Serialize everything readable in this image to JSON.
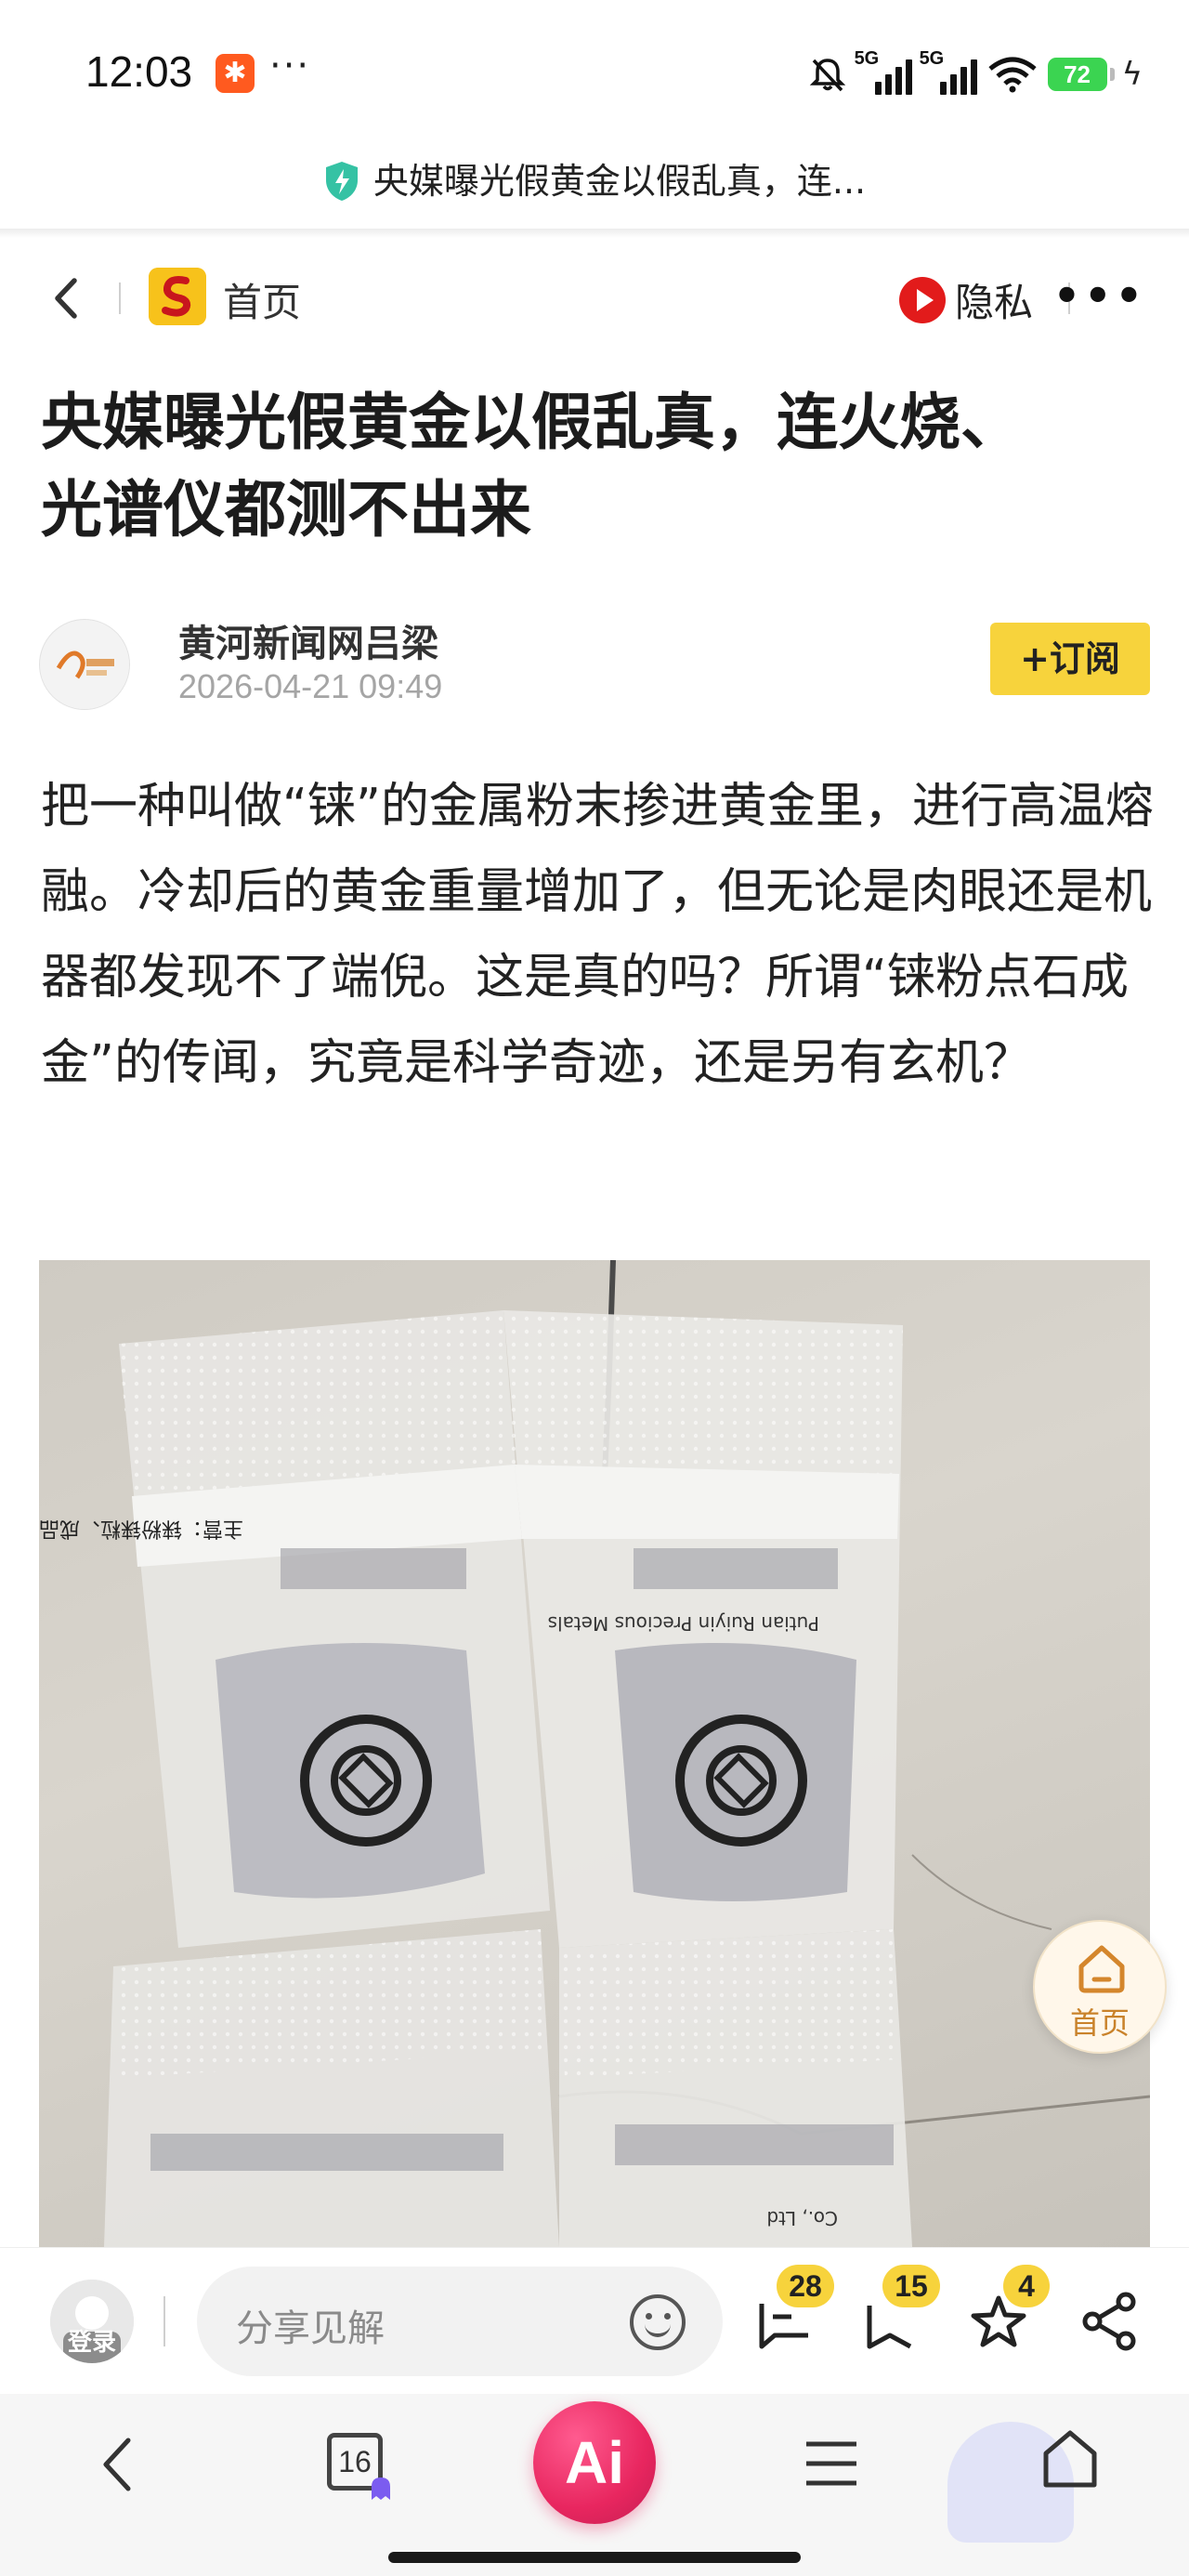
{
  "status_bar": {
    "time": "12:03",
    "more": "···",
    "net1": "5G",
    "net2": "5G",
    "battery": "72"
  },
  "page_tab_title": "央媒曝光假黄金以假乱真，连...",
  "nav": {
    "home_label": "首页",
    "privacy_label": "隐私"
  },
  "article": {
    "title_line1": "央媒曝光假黄金以假乱真，连火烧、",
    "title_line2": "光谱仪都测不出来",
    "author": "黄河新闻网吕梁",
    "date": "2026-04-21 09:49",
    "subscribe_label": "+订阅",
    "body": "把一种叫做“铼”的金属粉末掺进黄金里，进行高温熔融。冷却后的黄金重量增加了，但无论是肉眼还是机器都发现不了端倪。这是真的吗？所谓“铼粉点石成金”的传闻，究竟是科学奇迹，还是另有玄机？",
    "image": {
      "bag_label": "主营：铼粉铼粒、成品定制",
      "brand": "Putian Ruiyin Precious Metals",
      "co": "Co., Ltd"
    }
  },
  "float_home_label": "首页",
  "actions": {
    "login_label": "登录",
    "share_placeholder": "分享见解",
    "comment_count": "28",
    "favorite_count": "15",
    "like_count": "4"
  },
  "browser": {
    "tab_count": "16",
    "ai_label": "Ai"
  }
}
